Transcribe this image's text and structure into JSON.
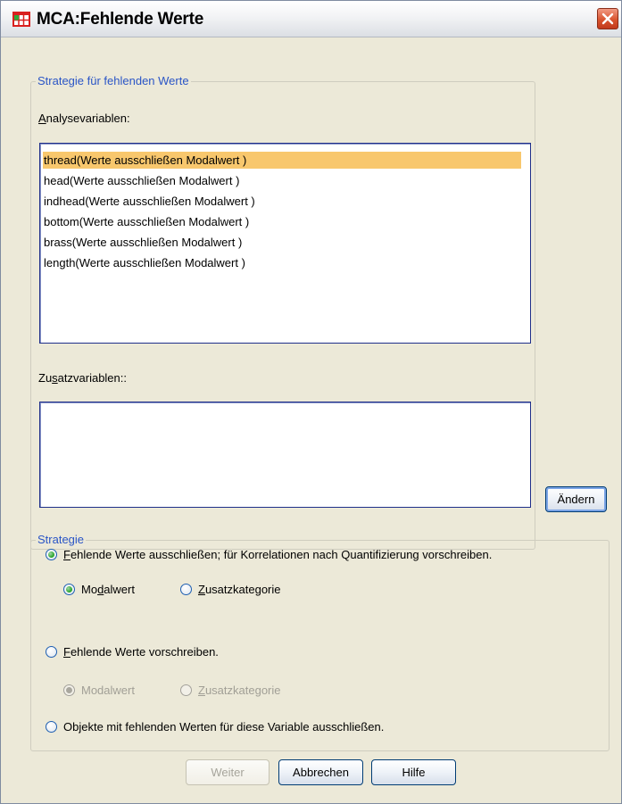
{
  "window": {
    "title": "MCA:Fehlende Werte"
  },
  "strategy_group": {
    "legend": "Strategie für fehlenden Werte",
    "analysis_label_u": "A",
    "analysis_label_rest": "nalysevariablen:",
    "analysis_items": [
      "thread(Werte ausschließen Modalwert )",
      "head(Werte ausschließen Modalwert )",
      "indhead(Werte ausschließen Modalwert )",
      "bottom(Werte ausschließen Modalwert )",
      "brass(Werte ausschließen Modalwert )",
      "length(Werte ausschließen Modalwert )"
    ],
    "supp_label_a": "Zu",
    "supp_label_u": "s",
    "supp_label_b": "atzvariablen::"
  },
  "change_button": "Ändern",
  "strategie": {
    "legend": "Strategie",
    "opt1_u": "F",
    "opt1_rest": "ehlende Werte ausschließen; für Korrelationen nach Quantifizierung vorschreiben.",
    "opt1_sub_mode_a": "Mo",
    "opt1_sub_mode_u": "d",
    "opt1_sub_mode_b": "alwert",
    "opt1_sub_extra_u": "Z",
    "opt1_sub_extra_rest": "usatzkategorie",
    "opt2_u": "F",
    "opt2_rest": "ehlende Werte vorschreiben.",
    "opt2_sub_mode": "Modalwert",
    "opt2_sub_extra_u": "Z",
    "opt2_sub_extra_rest": "usatzkategorie",
    "opt3_a": "Ob",
    "opt3_u": "j",
    "opt3_b": "ekte mit fehlenden Werten für diese Variable ausschließen."
  },
  "buttons": {
    "continue": "Weiter",
    "cancel": "Abbrechen",
    "help": "Hilfe"
  }
}
